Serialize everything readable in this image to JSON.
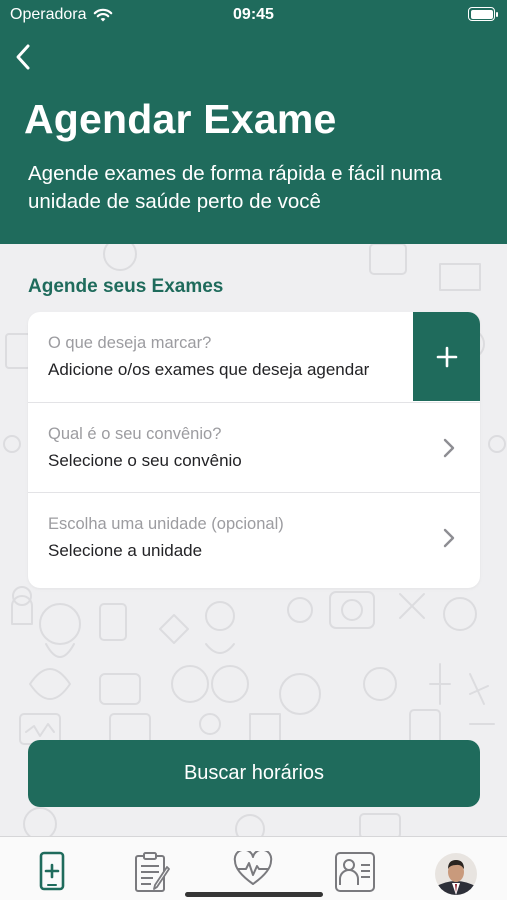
{
  "status_bar": {
    "carrier": "Operadora",
    "time": "09:45"
  },
  "header": {
    "title": "Agendar Exame",
    "subtitle": "Agende exames de forma rápida e fácil numa unidade de saúde perto de você"
  },
  "section_title": "Agende seus Exames",
  "form": {
    "exams": {
      "label": "O que deseja marcar?",
      "value": "Adicione o/os exames que deseja agendar"
    },
    "insurance": {
      "label": "Qual é o seu convênio?",
      "value": "Selecione o seu convênio"
    },
    "unit": {
      "label": "Escolha uma unidade (opcional)",
      "value": "Selecione a unidade"
    }
  },
  "search_button": "Buscar horários",
  "colors": {
    "brand": "#1f6b5c",
    "background": "#efeff1",
    "label": "#9c9ca0"
  },
  "tabs": [
    {
      "icon": "phone-plus-icon",
      "active": true
    },
    {
      "icon": "clipboard-icon",
      "active": false
    },
    {
      "icon": "heartbeat-icon",
      "active": false
    },
    {
      "icon": "doctor-card-icon",
      "active": false
    },
    {
      "icon": "avatar",
      "active": false
    }
  ]
}
